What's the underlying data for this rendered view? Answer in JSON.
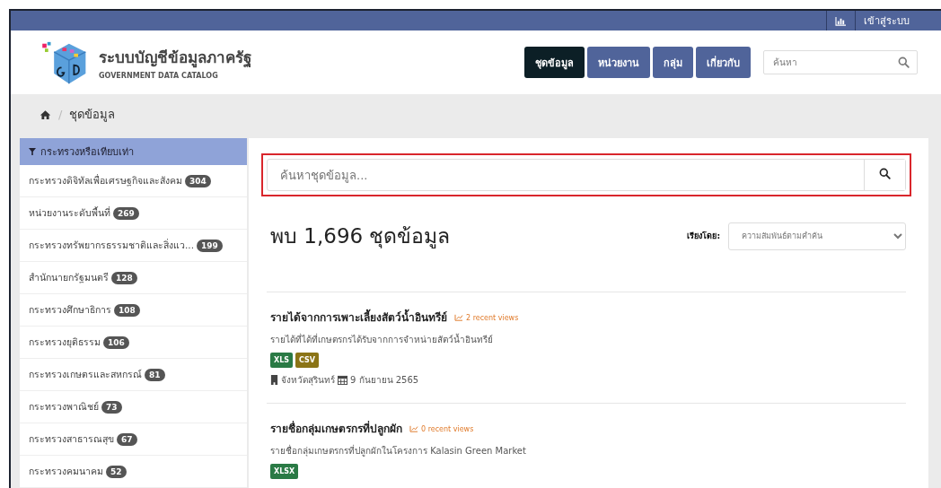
{
  "top_bar": {
    "login_label": "เข้าสู่ระบบ"
  },
  "header": {
    "title": "ระบบบัญชีข้อมูลภาครัฐ",
    "subtitle": "GOVERNMENT DATA CATALOG",
    "nav": [
      {
        "label": "ชุดข้อมูล",
        "selected": true
      },
      {
        "label": "หน่วยงาน",
        "selected": false
      },
      {
        "label": "กลุ่ม",
        "selected": false
      },
      {
        "label": "เกี่ยวกับ",
        "selected": false
      }
    ],
    "search": {
      "placeholder": "ค้นหา"
    }
  },
  "breadcrumb": {
    "separator": "/",
    "current": "ชุดข้อมูล"
  },
  "sidebar": {
    "title": "กระทรวงหรือเทียบเท่า",
    "items": [
      {
        "label": "กระทรวงดิจิทัลเพื่อเศรษฐกิจและสังคม",
        "count": "304"
      },
      {
        "label": "หน่วยงานระดับพื้นที่",
        "count": "269"
      },
      {
        "label": "กระทรวงทรัพยากรธรรมชาติและสิ่งแว...",
        "count": "199"
      },
      {
        "label": "สำนักนายกรัฐมนตรี",
        "count": "128"
      },
      {
        "label": "กระทรวงศึกษาธิการ",
        "count": "108"
      },
      {
        "label": "กระทรวงยุติธรรม",
        "count": "106"
      },
      {
        "label": "กระทรวงเกษตรและสหกรณ์",
        "count": "81"
      },
      {
        "label": "กระทรวงพาณิชย์",
        "count": "73"
      },
      {
        "label": "กระทรวงสาธารณสุข",
        "count": "67"
      },
      {
        "label": "กระทรวงคมนาคม",
        "count": "52"
      }
    ]
  },
  "dataset_search": {
    "placeholder": "ค้นหาชุดข้อมูล...",
    "highlighted": true
  },
  "results": {
    "heading": "พบ 1,696 ชุดข้อมูล",
    "sort_label": "เรียงโดย:",
    "sort_value": "ความสัมพันธ์ตามคำค้น"
  },
  "datasets": [
    {
      "title": "รายได้จากการเพาะเลี้ยงสัตว์น้ำอินทรีย์",
      "views": "2 recent views",
      "description": "รายได้ที่ได้ที่เกษตรกรได้รับจากการจำหน่ายสัตว์น้ำอินทรีย์",
      "formats": [
        {
          "label": "XLS",
          "color": "#2a7a45"
        },
        {
          "label": "CSV",
          "color": "#8b7416"
        }
      ],
      "organization": "จังหวัดสุรินทร์",
      "date": "9 กันยายน 2565"
    },
    {
      "title": "รายชื่อกลุ่มเกษตรกรที่ปลูกผัก",
      "views": "0 recent views",
      "description": "รายชื่อกลุ่มเกษตรกรที่ปลูกผักในโครงการ Kalasin Green Market",
      "formats": [
        {
          "label": "XLSX",
          "color": "#2a7a45"
        }
      ]
    }
  ]
}
